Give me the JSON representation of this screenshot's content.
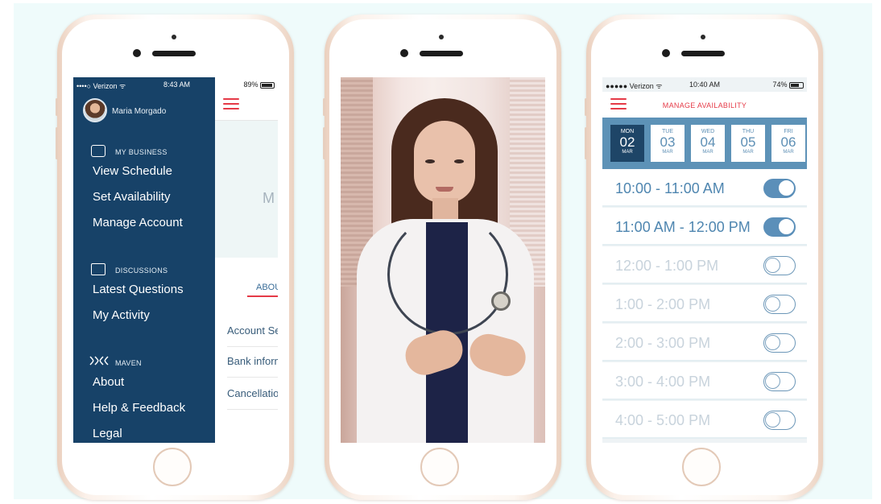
{
  "phone1": {
    "status": {
      "carrier": "••••○ Verizon ᯤ",
      "time": "8:43 AM",
      "battery": "89%"
    },
    "user_name": "Maria Morgado",
    "sections": [
      {
        "title": "MY BUSINESS",
        "icon": "wallet-icon",
        "items": [
          "View Schedule",
          "Set Availability",
          "Manage Account"
        ]
      },
      {
        "title": "DISCUSSIONS",
        "icon": "chat-icon",
        "items": [
          "Latest Questions",
          "My Activity"
        ]
      },
      {
        "title": "MAVEN",
        "icon": "maven-logo-icon",
        "items": [
          "About",
          "Help & Feedback",
          "Legal"
        ]
      }
    ],
    "background_screen": {
      "hero_letter": "M",
      "tab": "ABOU",
      "rows": [
        "Account Se",
        "Bank inform",
        "Cancellatio"
      ]
    }
  },
  "phone2": {
    "content": "video-frame"
  },
  "phone3": {
    "status": {
      "carrier": "●●●●● Verizon ᯤ",
      "time": "10:40 AM",
      "battery": "74%"
    },
    "title": "MANAGE AVAILABILITY",
    "days": [
      {
        "name": "MON",
        "date": "02",
        "month": "MAR",
        "active": true
      },
      {
        "name": "TUE",
        "date": "03",
        "month": "MAR",
        "active": false
      },
      {
        "name": "WED",
        "date": "04",
        "month": "MAR",
        "active": false
      },
      {
        "name": "THU",
        "date": "05",
        "month": "MAR",
        "active": false
      },
      {
        "name": "FRI",
        "date": "06",
        "month": "MAR",
        "active": false
      }
    ],
    "slots": [
      {
        "label": "10:00 - 11:00 AM",
        "on": true
      },
      {
        "label": "11:00 AM - 12:00 PM",
        "on": true
      },
      {
        "label": "12:00 - 1:00 PM",
        "on": false
      },
      {
        "label": "1:00 - 2:00 PM",
        "on": false
      },
      {
        "label": "2:00 - 3:00 PM",
        "on": false
      },
      {
        "label": "3:00 - 4:00 PM",
        "on": false
      },
      {
        "label": "4:00 - 5:00 PM",
        "on": false
      }
    ]
  },
  "colors": {
    "accent_red": "#e53a47",
    "drawer_blue": "#174268",
    "day_strip_blue": "#5d92b7",
    "toggle_on": "#5b8fb9",
    "backdrop": "#effbfb"
  }
}
